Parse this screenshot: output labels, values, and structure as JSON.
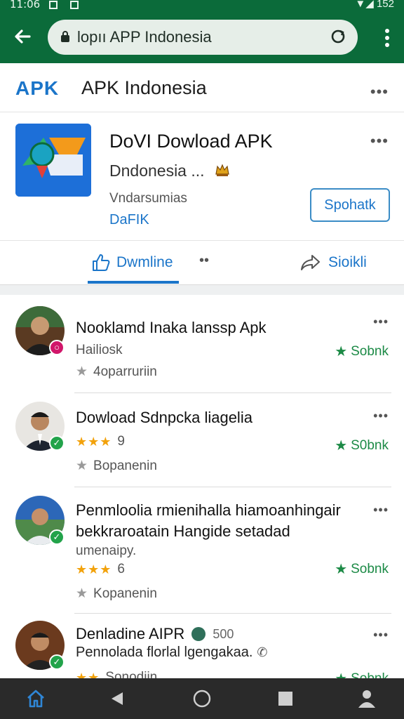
{
  "status_bar": {
    "time": "11:06",
    "battery": "152"
  },
  "browser": {
    "url": "lopıı APP Indonesia"
  },
  "header": {
    "logo": "APK",
    "title": "APK Indonesia",
    "more": "•••"
  },
  "app_card": {
    "name": "DoVI Dowload APK",
    "subtitle": "Dndonesia ...",
    "developer": "Vndarsumias",
    "tag": "DaFIK",
    "action_label": "Spohatk",
    "more": "•••",
    "tab_download": "Dwmline",
    "tab_dots": "••",
    "tab_share": "Sioikli"
  },
  "reviews": [
    {
      "title": "Nooklamd Inaka lanssp Apk",
      "meta": "Hailiosk",
      "footer": "4oparruriin",
      "badge": "Sobnk",
      "badge_color": "#d1166a",
      "more": "•••"
    },
    {
      "title": "Dowload Sdnpcka liagelia",
      "stars": "★★★",
      "rating": "9",
      "footer": "Bopanenin",
      "badge": "S0bnk",
      "badge_color": "#22a34a",
      "more": "•••"
    },
    {
      "title_line1": "Penmloolia rmienihalla hiamoanhingair",
      "title_line2": "bekkraroatain Hangide setadad",
      "title_line3": "umenaipy.",
      "stars": "★★★",
      "rating": "6",
      "footer": "Kopanenin",
      "badge": "Sobnk",
      "badge_color": "#22a34a",
      "more": "•••"
    },
    {
      "title": "Denladine AIPR",
      "extra": "500",
      "meta": "Pennolada florlal lgengakaa.",
      "stars": "★★",
      "footer": "Sonodiin",
      "badge": "Sobnk",
      "badge_color": "#22a34a",
      "more": "•••"
    }
  ],
  "colors": {
    "brand_green": "#0b6b3a",
    "accent_blue": "#1b75c9",
    "rating_green": "#1c8a46",
    "star_gold": "#f2a20c"
  }
}
